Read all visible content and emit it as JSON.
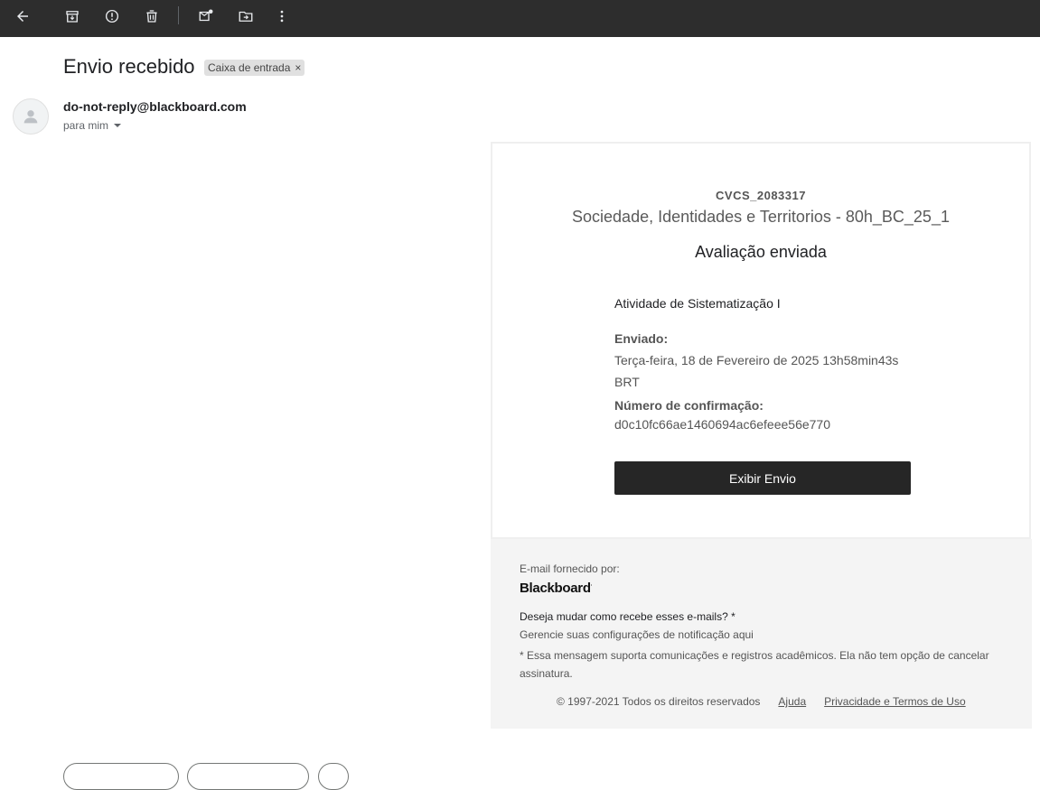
{
  "toolbar": {
    "icons": [
      "back-arrow-icon",
      "archive-icon",
      "report-spam-icon",
      "delete-icon",
      "mark-unread-icon",
      "move-to-icon",
      "more-vert-icon"
    ]
  },
  "message": {
    "subject": "Envio recebido",
    "label": "Caixa de entrada",
    "label_close": "×",
    "sender": "do-not-reply@blackboard.com",
    "to": "para mim"
  },
  "email": {
    "course_id": "CVCS_2083317",
    "course_name": "Sociedade, Identidades e Territorios - 80h_BC_25_1",
    "status_title": "Avaliação enviada",
    "assignment": "Atividade de Sistematização I",
    "sent_label": "Enviado:",
    "sent_value": "Terça-feira, 18 de Fevereiro de 2025 13h58min43s BRT",
    "confirmation_label": "Número de confirmação:",
    "confirmation_value": "d0c10fc66ae1460694ac6efeee56e770",
    "view_button": "Exibir Envio"
  },
  "footer": {
    "provided_by": "E-mail fornecido por:",
    "logo": "Blackboard",
    "question": "Deseja mudar como recebe esses e-mails? *",
    "manage": "Gerencie suas configurações de notificação aqui",
    "note": "* Essa mensagem suporta comunicações e registros acadêmicos. Ela não tem opção de cancelar assinatura.",
    "copyright": "© 1997-2021 Todos os direitos reservados",
    "help": "Ajuda",
    "privacy": "Privacidade e Termos de Uso"
  },
  "colors": {
    "toolbar_bg": "#2d2d2d",
    "button_bg": "#262626",
    "footer_bg": "#f4f4f4"
  }
}
